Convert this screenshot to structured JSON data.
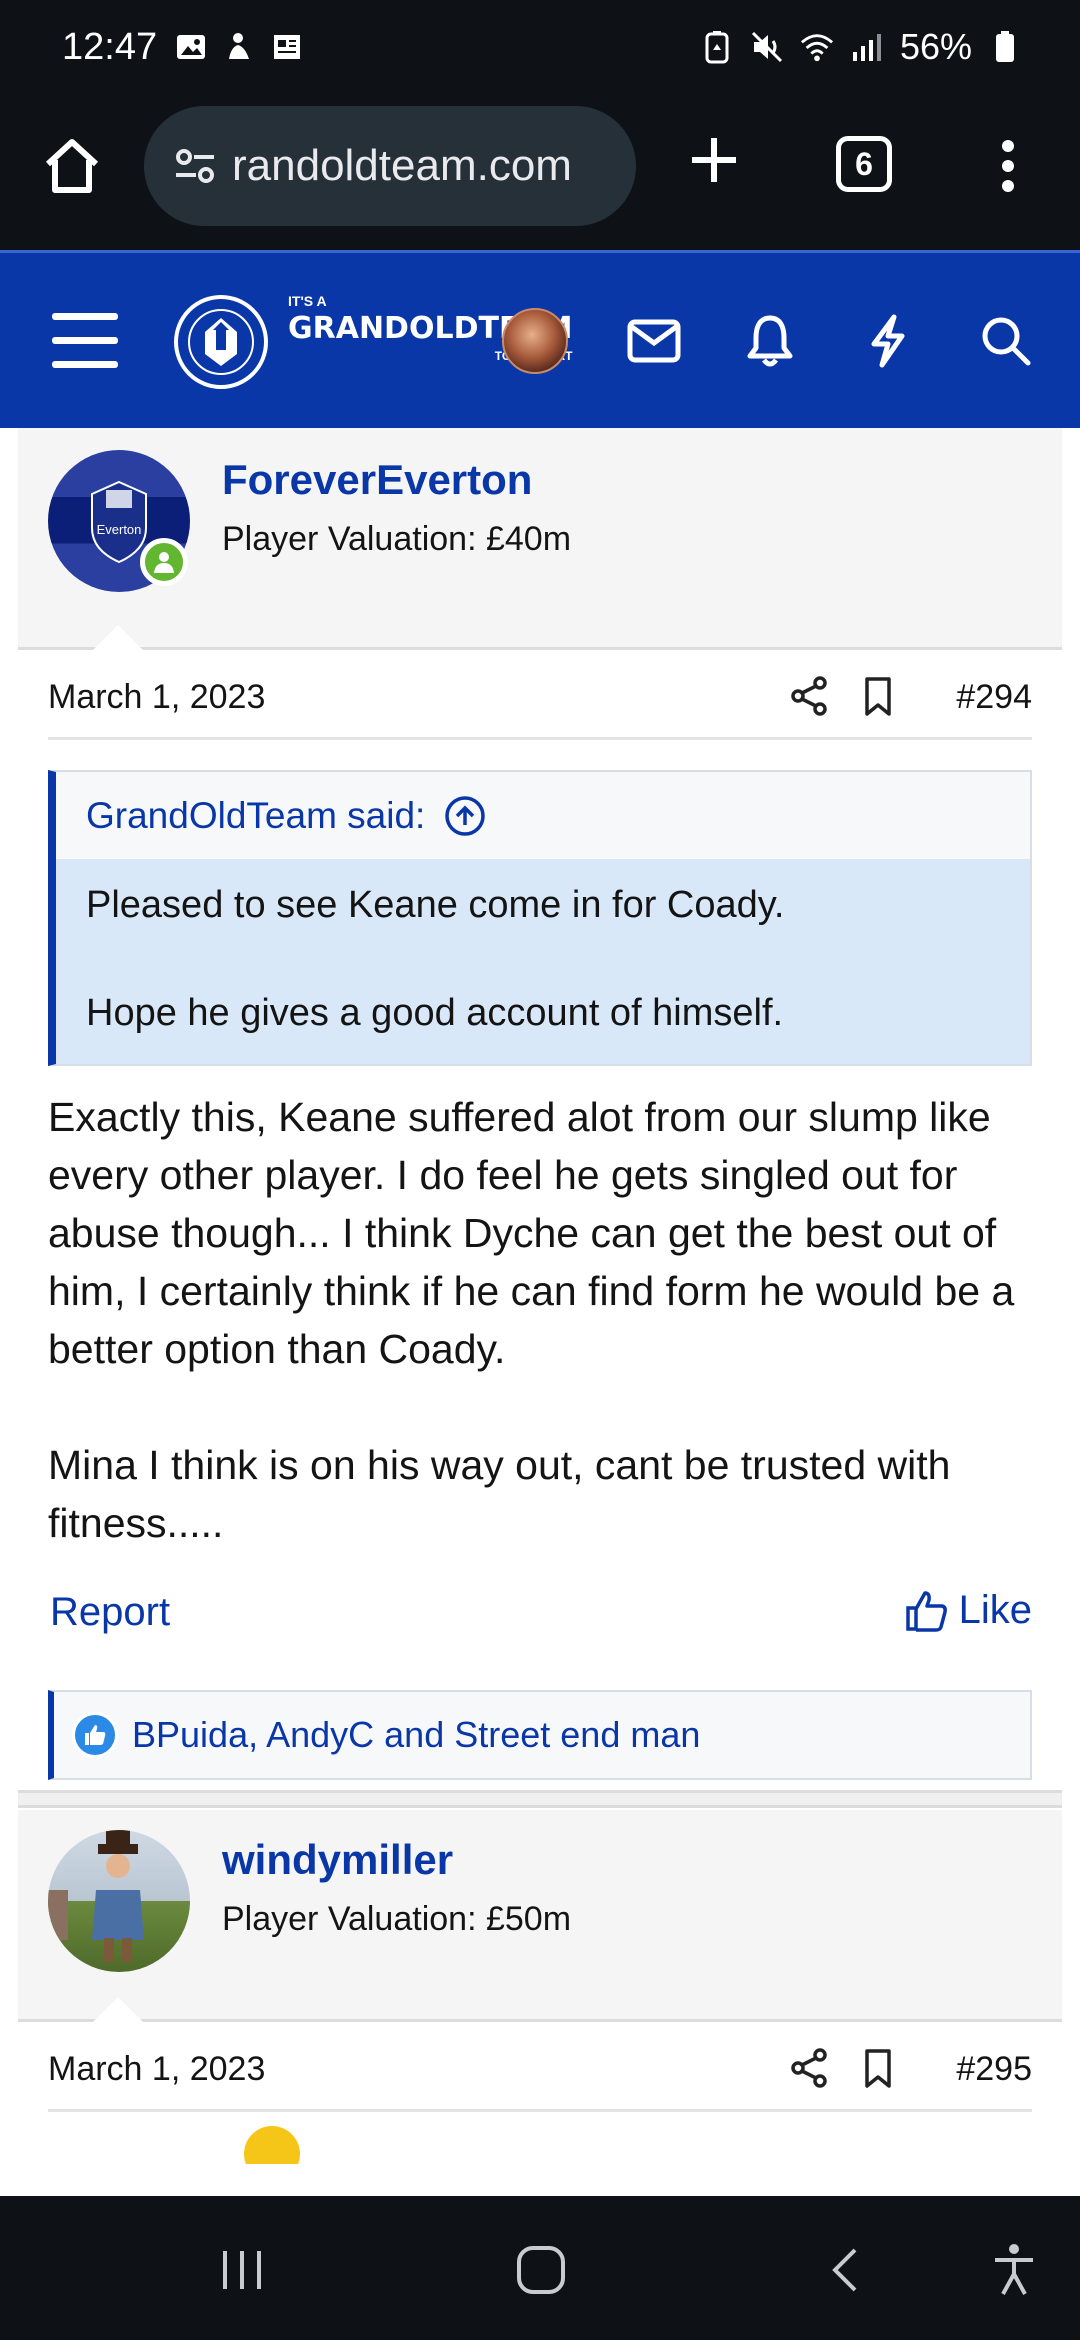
{
  "status_bar": {
    "time": "12:47",
    "battery": "56%",
    "icons": [
      "gallery-icon",
      "accessibility-person-icon",
      "news-icon",
      "battery-saver-icon",
      "mute-icon",
      "wifi-icon",
      "signal-icon",
      "battery-icon"
    ]
  },
  "browser": {
    "url": "randoldteam.com",
    "tab_count": "6",
    "icons": [
      "home-icon",
      "site-settings-icon",
      "new-tab-icon",
      "tab-switcher-icon",
      "more-menu-icon"
    ]
  },
  "site_header": {
    "logo_its": "IT'S A",
    "logo_main": "GRANDOLDTEAM",
    "logo_sub": "TO SUPPORT",
    "icons": [
      "hamburger-menu-icon",
      "user-avatar",
      "mail-icon",
      "bell-icon",
      "lightning-icon",
      "search-icon"
    ],
    "colors": {
      "primary": "#0a37a8"
    }
  },
  "posts": [
    {
      "username": "ForeverEverton",
      "valuation": "Player Valuation: £40m",
      "avatar_text": "Everton",
      "online": true,
      "date": "March 1, 2023",
      "number": "#294",
      "quote": {
        "author": "GrandOldTeam said:",
        "paragraphs": [
          "Pleased to see Keane come in for Coady.",
          "Hope he gives a good account of himself."
        ]
      },
      "body": [
        "Exactly this, Keane suffered alot from our slump like every other player. I do feel he gets singled out for abuse though... I think Dyche can get the best out of him, I certainly think if he can find form he would be a better option than Coady.",
        "Mina I think is on his way out, cant be trusted with fitness....."
      ],
      "report_label": "Report",
      "like_label": "Like",
      "reactions": "BPuida, AndyC and Street end man"
    },
    {
      "username": "windymiller",
      "valuation": "Player Valuation: £50m",
      "date": "March 1, 2023",
      "number": "#295"
    }
  ],
  "nav_bar": {
    "icons": [
      "recent-apps-icon",
      "home-circle-icon",
      "back-icon",
      "accessibility-icon"
    ]
  }
}
